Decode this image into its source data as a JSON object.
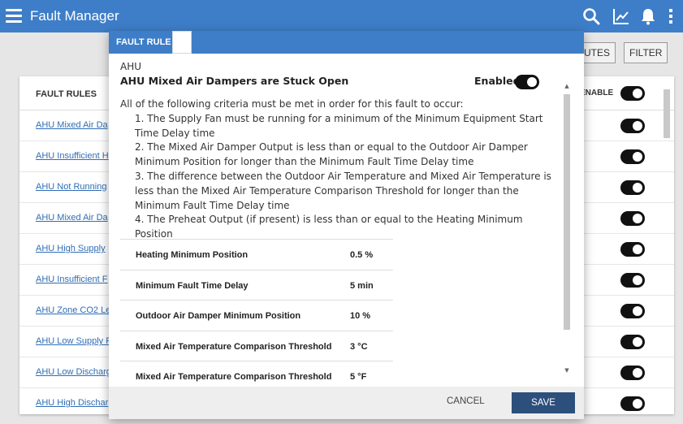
{
  "app": {
    "title": "Fault Manager"
  },
  "toolbar": {
    "attributes_label": "UTES",
    "filter_label": "FILTER"
  },
  "table": {
    "header_col": "FAULT RULES",
    "header_enable": "ENABLE",
    "rows": [
      "AHU Mixed Air Da",
      "AHU Insufficient H",
      "AHU Not Running",
      "AHU Mixed Air Da",
      "AHU High Supply",
      "AHU Insufficient F",
      "AHU Zone CO2 Le",
      "AHU Low Supply F",
      "AHU Low Discharg",
      "AHU High Dischar"
    ]
  },
  "modal": {
    "header": "FAULT RULE",
    "category": "AHU",
    "rule_name": "AHU Mixed Air Dampers are Stuck Open",
    "enabled_label": "Enabled",
    "enabled": true,
    "description": {
      "intro": "All of the following criteria must be met in order for this fault to occur:",
      "c1": "1. The Supply Fan must be running for a minimum of the Minimum Equipment Start Time Delay time",
      "c2": "2. The Mixed Air Damper Output is less than or equal to the Outdoor Air Damper Minimum Position for longer than the Minimum Fault Time Delay time",
      "c3": "3. The difference between the Outdoor Air Temperature and Mixed Air Temperature is less than the Mixed Air Temperature Comparison Threshold for longer than the Minimum Fault Time Delay time",
      "c4": "4. The Preheat Output (if present) is less than or equal to the Heating Minimum Position"
    },
    "params": [
      {
        "name": "Heating Minimum Position",
        "value": "0.5 %"
      },
      {
        "name": "Minimum Fault Time Delay",
        "value": "5 min"
      },
      {
        "name": "Outdoor Air Damper Minimum Position",
        "value": "10 %"
      },
      {
        "name": "Mixed Air Temperature Comparison Threshold",
        "value": "3 °C"
      },
      {
        "name": "Mixed Air Temperature Comparison Threshold",
        "value": "5 °F"
      }
    ],
    "cancel_label": "CANCEL",
    "save_label": "SAVE"
  },
  "colors": {
    "appbar": "#3e7ec8",
    "save_button": "#2c4f7c",
    "link": "#2f6db5"
  },
  "icons": [
    "menu-icon",
    "search-icon",
    "trend-chart-icon",
    "bell-icon",
    "more-vertical-icon"
  ]
}
